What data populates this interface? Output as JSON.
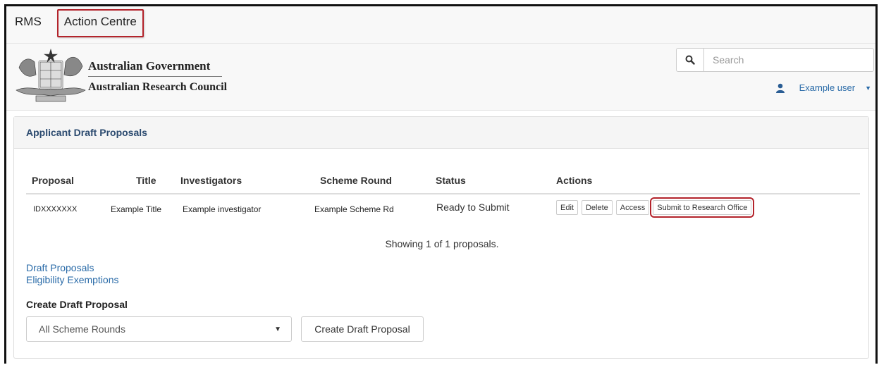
{
  "nav": {
    "items": [
      "RMS",
      "Action Centre"
    ],
    "active_index": 1
  },
  "header": {
    "gov_line1": "Australian Government",
    "gov_line2": "Australian Research Council",
    "search_placeholder": "Search",
    "search_icon": "search-icon",
    "user_icon": "user-icon",
    "user_name": "Example user"
  },
  "panel": {
    "heading": "Applicant Draft Proposals",
    "columns": [
      "Proposal",
      "Title",
      "Investigators",
      "Scheme Round",
      "Status",
      "Actions"
    ],
    "rows": [
      {
        "proposal": "IDXXXXXXX",
        "title": "Example Title",
        "investigators": "Example investigator",
        "scheme_round": "Example Scheme Rd",
        "status": "Ready to Submit",
        "actions": [
          "Edit",
          "Delete",
          "Access",
          "Submit to Research Office"
        ]
      }
    ],
    "showing": "Showing 1 of 1 proposals.",
    "links": [
      "Draft Proposals",
      "Eligibility Exemptions"
    ],
    "create_label": "Create Draft Proposal",
    "select_value": "All Scheme Rounds",
    "create_button": "Create Draft Proposal"
  },
  "colors": {
    "highlight": "#b3232b",
    "link": "#2a6ba8",
    "heading": "#2b4a6f"
  }
}
